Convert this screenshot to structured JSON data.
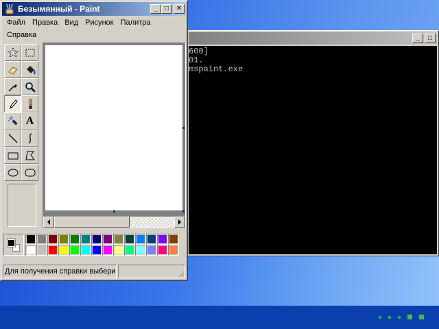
{
  "paint": {
    "title": "Безымянный - Paint",
    "window_buttons": {
      "minimize": "_",
      "maximize": "□",
      "close": "✕"
    },
    "menu_row1": [
      "Файл",
      "Правка",
      "Вид",
      "Рисунок",
      "Палитра"
    ],
    "menu_row2": [
      "Справка"
    ],
    "tools": [
      {
        "name": "free-form-select",
        "icon": "star-select-icon"
      },
      {
        "name": "select",
        "icon": "rect-select-icon"
      },
      {
        "name": "eraser",
        "icon": "eraser-icon"
      },
      {
        "name": "fill",
        "icon": "paint-bucket-icon"
      },
      {
        "name": "pick-color",
        "icon": "eyedropper-icon"
      },
      {
        "name": "magnifier",
        "icon": "magnifier-icon"
      },
      {
        "name": "pencil",
        "icon": "pencil-icon",
        "active": true
      },
      {
        "name": "brush",
        "icon": "brush-icon"
      },
      {
        "name": "airbrush",
        "icon": "airbrush-icon"
      },
      {
        "name": "text",
        "icon": "text-icon",
        "glyph": "A"
      },
      {
        "name": "line",
        "icon": "line-icon"
      },
      {
        "name": "curve",
        "icon": "curve-icon"
      },
      {
        "name": "rectangle",
        "icon": "rectangle-icon"
      },
      {
        "name": "polygon",
        "icon": "polygon-icon"
      },
      {
        "name": "ellipse",
        "icon": "ellipse-icon"
      },
      {
        "name": "rounded-rectangle",
        "icon": "rounded-rect-icon"
      }
    ],
    "palette_row1": [
      "#000000",
      "#808080",
      "#800000",
      "#808000",
      "#008000",
      "#008080",
      "#000080",
      "#800080",
      "#808040",
      "#004040",
      "#0080ff",
      "#004080",
      "#8000ff",
      "#804000"
    ],
    "palette_row2": [
      "#ffffff",
      "#c0c0c0",
      "#ff0000",
      "#ffff00",
      "#00ff00",
      "#00ffff",
      "#0000ff",
      "#ff00ff",
      "#ffff80",
      "#00ff80",
      "#80ffff",
      "#8080ff",
      "#ff0080",
      "#ff8040"
    ],
    "foreground_color": "#000000",
    "background_color": "#ffffff",
    "status_text": "Для получения справки выбери",
    "status_coords": ""
  },
  "console": {
    "lines": [
      "600]",
      "01.",
      "",
      "mspaint.exe"
    ]
  }
}
